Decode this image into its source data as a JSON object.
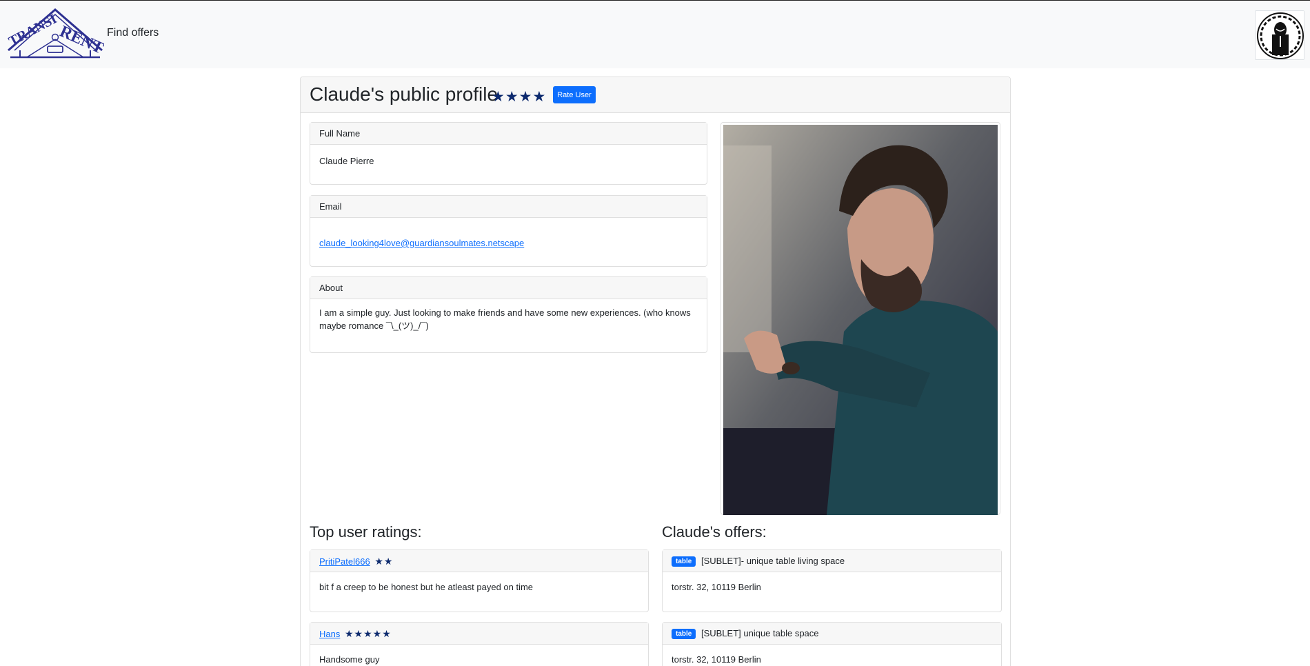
{
  "nav": {
    "logo_text": "TRANSIRENT",
    "find_offers": "Find offers"
  },
  "profile": {
    "title": "Claude's public profile",
    "stars": "★★★★",
    "rate_button": "Rate User",
    "full_name_label": "Full Name",
    "full_name": "Claude Pierre",
    "email_label": "Email",
    "email": "claude_looking4love@guardiansoulmates.netscape",
    "about_label": "About",
    "about": "I am a simple guy. Just looking to make friends and have some new experiences. (who knows maybe romance ¯\\_(ツ)_/¯)"
  },
  "ratings": {
    "heading": "Top user ratings:",
    "items": [
      {
        "user": "PritiPatel666",
        "stars": "★★",
        "text": "bit f a creep to be honest but he atleast payed on time"
      },
      {
        "user": "Hans",
        "stars": "★★★★★",
        "text": "Handsome guy"
      }
    ]
  },
  "offers": {
    "heading": "Claude's offers:",
    "items": [
      {
        "badge": "table",
        "title": "[SUBLET]- unique table living space",
        "address": "torstr. 32, 10119 Berlin"
      },
      {
        "badge": "table",
        "title": "[SUBLET] unique table space",
        "address": "torstr. 32, 10119 Berlin"
      }
    ]
  },
  "colors": {
    "primary": "#0d6efd",
    "star": "#0d2a6e",
    "navbar_bg": "#f8f9fa",
    "logo": "#2e3192"
  }
}
